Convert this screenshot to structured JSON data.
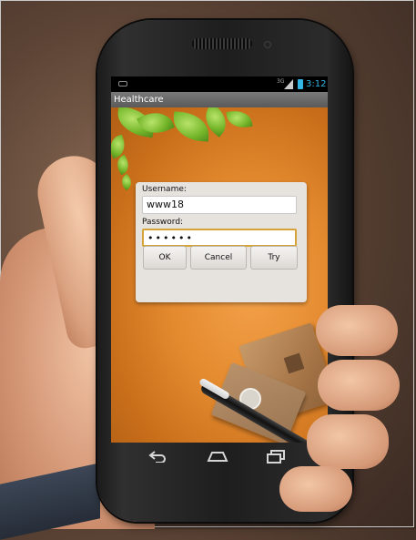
{
  "status_bar": {
    "network": "3G",
    "time": "3:12"
  },
  "app": {
    "title": "Healthcare"
  },
  "login_dialog": {
    "username_label": "Username:",
    "username_value": "www18",
    "password_label": "Password:",
    "password_value": "••••••",
    "buttons": {
      "ok": "OK",
      "cancel": "Cancel",
      "try": "Try"
    }
  },
  "navigation": {
    "icons": [
      "back-icon",
      "home-icon",
      "recent-apps-icon"
    ]
  },
  "colors": {
    "status_accent": "#33b5e5",
    "screen_background": "#e48a2f",
    "focus_border": "#d6a339",
    "dialog_background": "#e6e2de"
  }
}
